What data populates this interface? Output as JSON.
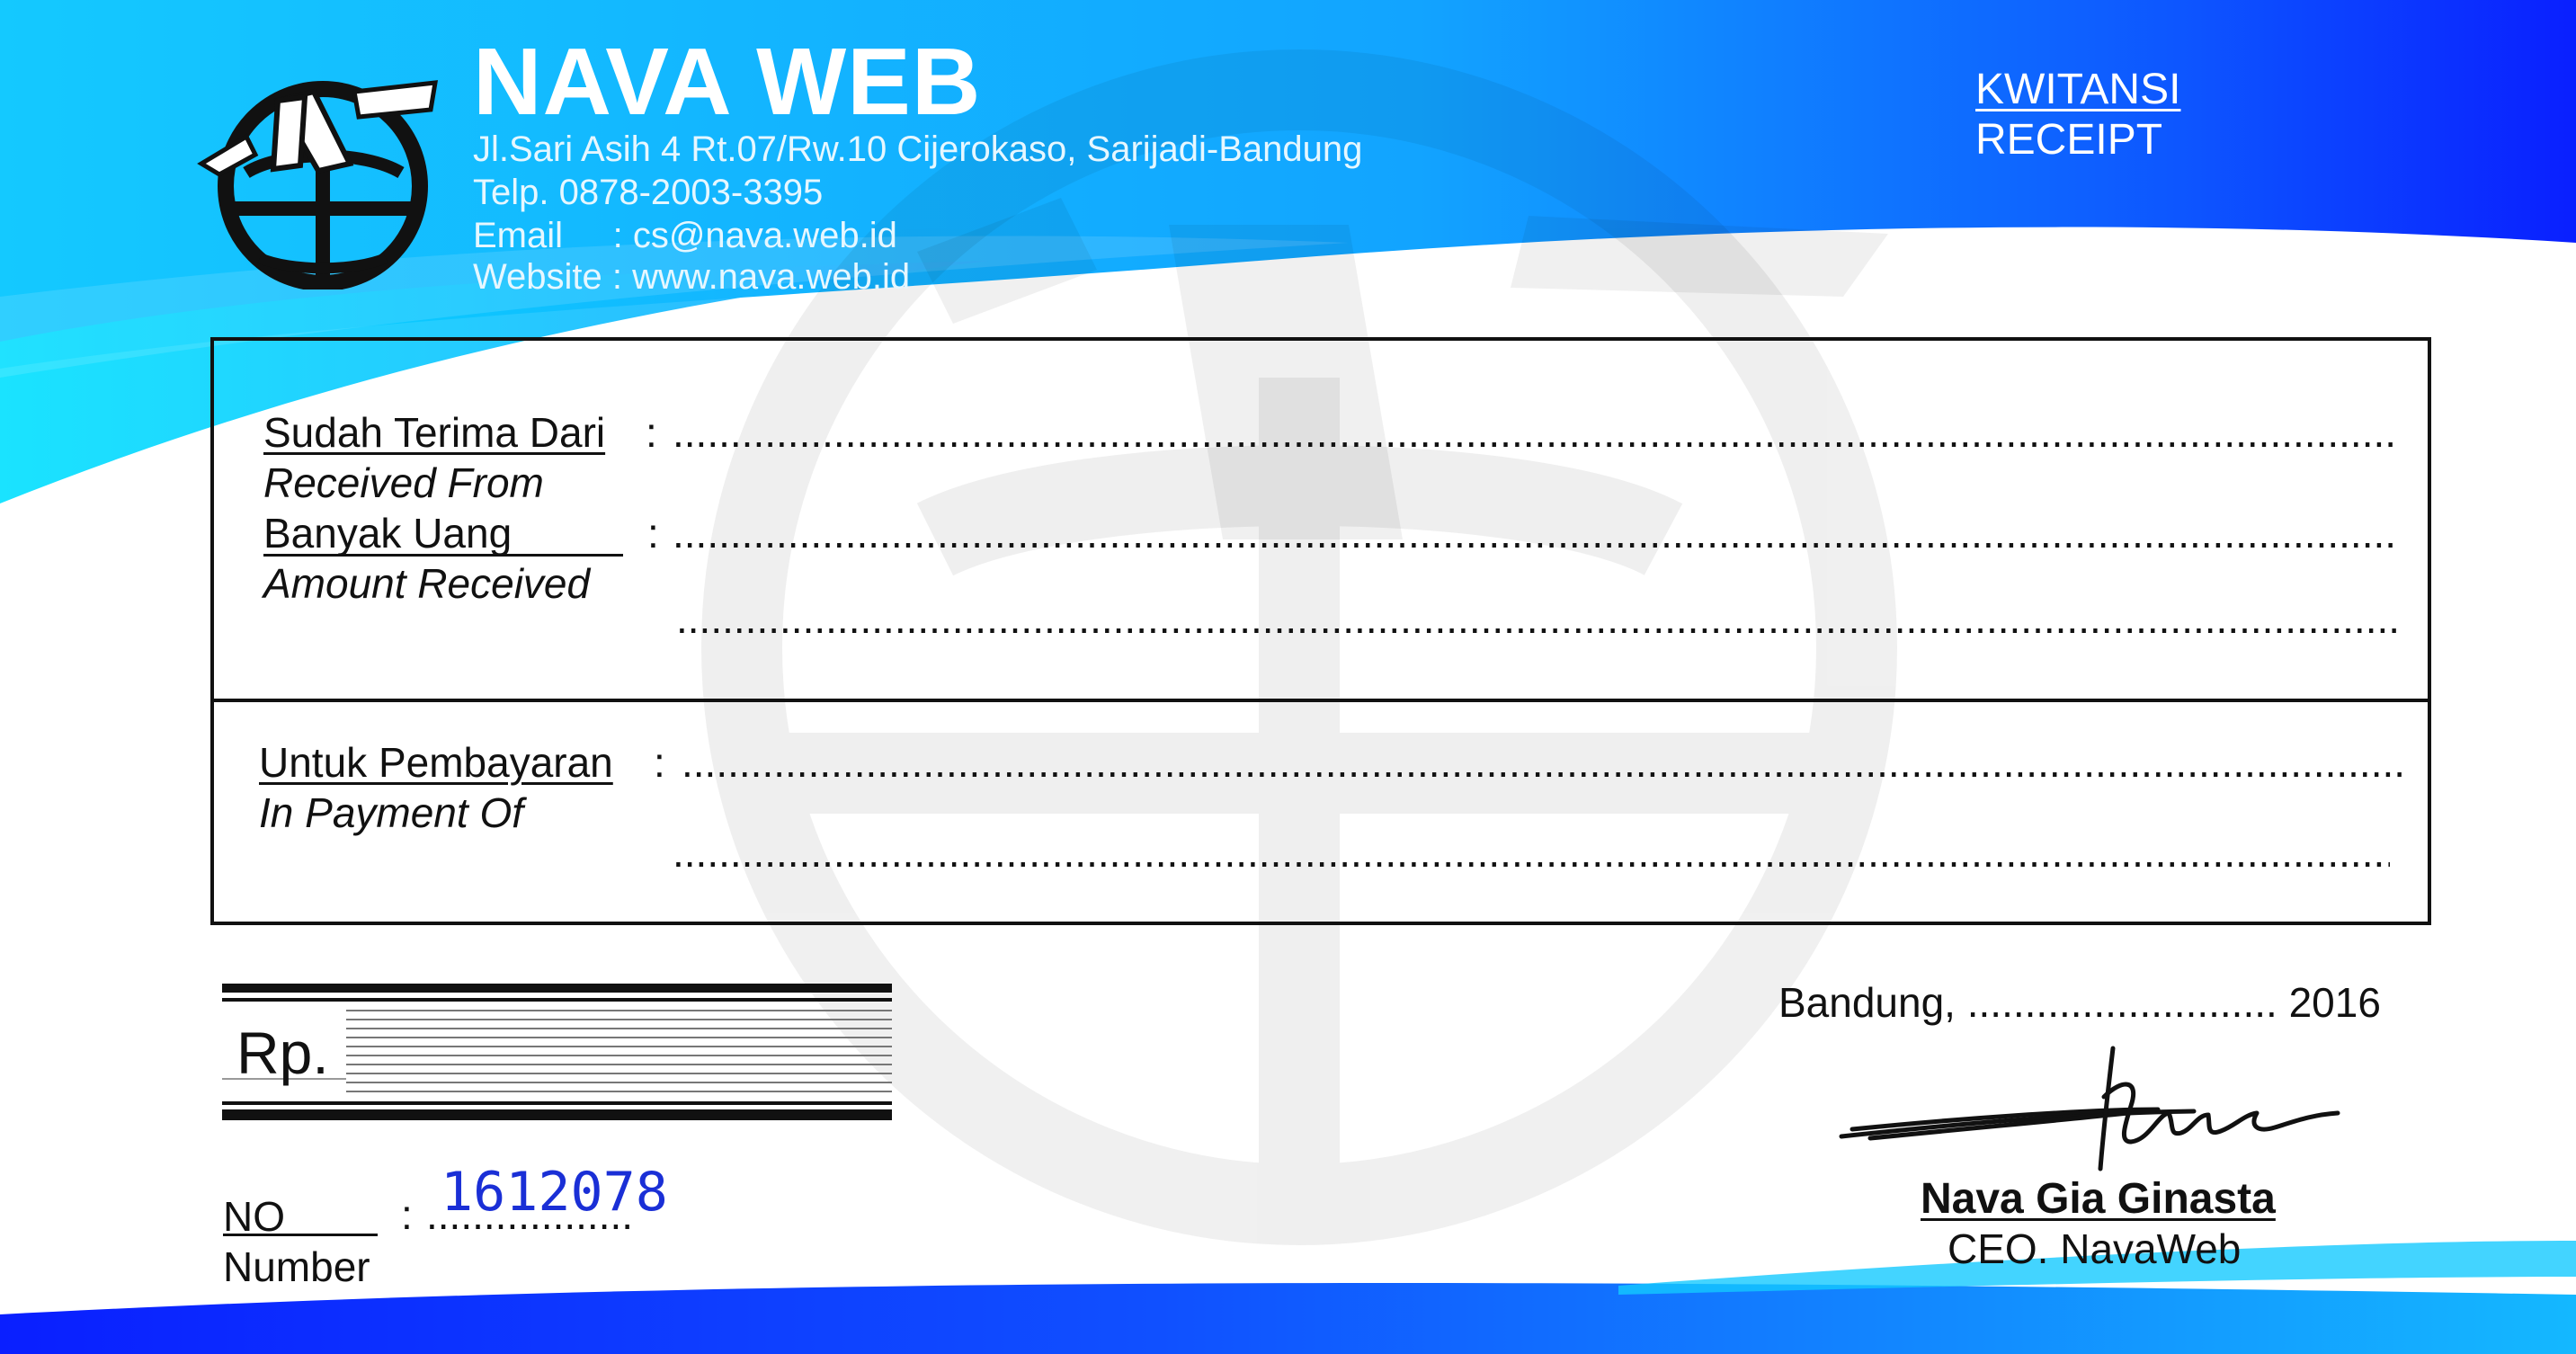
{
  "company": {
    "name": "NAVA WEB",
    "address": "Jl.Sari Asih 4 Rt.07/Rw.10 Cijerokaso, Sarijadi-Bandung",
    "phone": "Telp. 0878-2003-3395",
    "email": "Email     : cs@nava.web.id",
    "website": "Website : www.nava.web.id"
  },
  "document": {
    "title": "KWITANSI",
    "subtitle": "RECEIPT"
  },
  "fields": {
    "received_from_label": "Sudah Terima Dari",
    "received_from_label_en": "Received From",
    "amount_label": "Banyak Uang",
    "amount_label_en": "Amount Received",
    "payment_label": "Untuk Pembayaran",
    "payment_label_en": "In Payment Of",
    "colon": ":",
    "dots": "....................................................................................................................................................................................."
  },
  "amount": {
    "currency": "Rp."
  },
  "number": {
    "label": "NO",
    "label_en": "Number",
    "colon": ":",
    "dots": "..................",
    "value": "1612078"
  },
  "signature": {
    "place_date": "Bandung, ........................... 2016",
    "name": "Nava Gia Ginasta",
    "title": "CEO. NavaWeb"
  },
  "colors": {
    "primary_blue": "#0a2bff",
    "light_cyan": "#12c8ff",
    "text": "#111111",
    "number_ink": "#1a2fd6"
  }
}
